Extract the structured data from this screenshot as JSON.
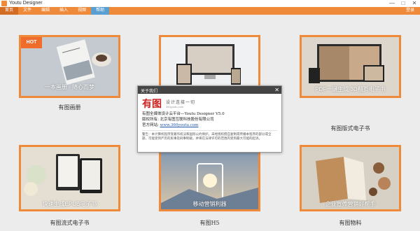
{
  "window": {
    "title": "Youtu Designer",
    "min_glyph": "—",
    "max_glyph": "□",
    "close_glyph": "✕"
  },
  "menu": {
    "items": [
      {
        "label": "首页",
        "state": "active"
      },
      {
        "label": "文件",
        "state": ""
      },
      {
        "label": "编辑",
        "state": ""
      },
      {
        "label": "插入",
        "state": ""
      },
      {
        "label": "视图",
        "state": ""
      },
      {
        "label": "帮助",
        "state": "help"
      }
    ],
    "login": "登录"
  },
  "cards": [
    {
      "caption": "有图画册",
      "overlay": "一本画册 · 随心而梦",
      "badge": "HOT"
    },
    {
      "caption": "",
      "overlay": ""
    },
    {
      "caption": "有图版式电子书",
      "overlay": "PDF一键生成 3D翻页电子书"
    },
    {
      "caption": "有图流式电子书",
      "overlay": "快速生成EPUB电子书"
    },
    {
      "caption": "有图H5",
      "overlay": "移动营销利器"
    },
    {
      "caption": "有图物料",
      "overlay": "企业宣传营销好帮手"
    }
  ],
  "dialog": {
    "title": "关于我们",
    "close_glyph": "✕",
    "logo_mark": "有图",
    "slogan": "设计连接一切",
    "logo_url": "360youtu.com",
    "product_line": "有图全媒体设计云平台—Youtu Designer V5.0",
    "copyright_line": "版权所有: 北京有图互联科技股份有限公司",
    "site_label": "官方网站: ",
    "site_url": "www.360youtu.com",
    "notice": "警告：本计算机程序受著作权法和国际公约保护。未经授权擅自复制或传播本程序的部分或全部，可能受到严厉的民事及刑事制裁，并将在法律许可的范围内受到最大可能的起诉。"
  },
  "colors": {
    "accent": "#ef8a3b",
    "help_tab": "#5a9fd1",
    "hot_badge": "#ef6c2b"
  }
}
